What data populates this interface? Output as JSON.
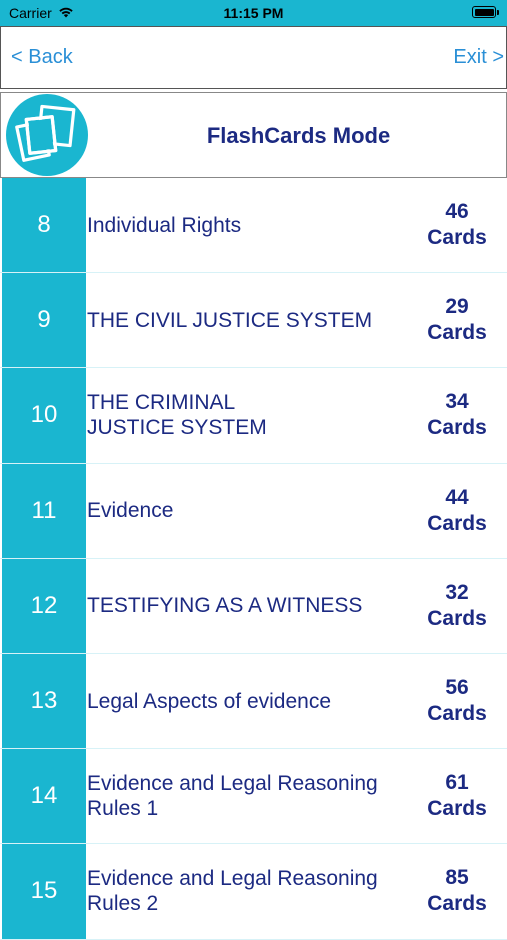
{
  "status_bar": {
    "carrier": "Carrier",
    "time": "11:15 PM",
    "icons": [
      "wifi-icon",
      "battery-icon"
    ]
  },
  "nav": {
    "back_label": "< Back",
    "exit_label": "Exit >"
  },
  "mode": {
    "title": "FlashCards Mode",
    "logo_icon": "flashcards-icon"
  },
  "colors": {
    "accent": "#1ab6d0",
    "text": "#1c2a82",
    "link": "#2a8fd6"
  },
  "rows": [
    {
      "num": "8",
      "title": "Individual Rights",
      "count": "46",
      "unit": "Cards"
    },
    {
      "num": "9",
      "title": "THE CIVIL JUSTICE SYSTEM",
      "count": "29",
      "unit": "Cards"
    },
    {
      "num": "10",
      "title": "THE CRIMINAL\nJUSTICE SYSTEM",
      "count": "34",
      "unit": "Cards"
    },
    {
      "num": "11",
      "title": "Evidence",
      "count": "44",
      "unit": "Cards"
    },
    {
      "num": "12",
      "title": "TESTIFYING AS A WITNESS",
      "count": "32",
      "unit": "Cards"
    },
    {
      "num": "13",
      "title": "Legal Aspects of evidence",
      "count": "56",
      "unit": "Cards"
    },
    {
      "num": "14",
      "title": "Evidence and Legal Reasoning\nRules 1",
      "count": "61",
      "unit": "Cards"
    },
    {
      "num": "15",
      "title": "Evidence and Legal Reasoning\nRules 2",
      "count": "85",
      "unit": "Cards"
    }
  ]
}
